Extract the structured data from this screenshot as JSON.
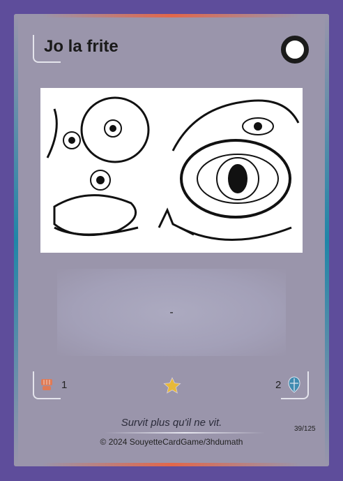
{
  "card": {
    "title": "Jo la frite",
    "effect_text": "-",
    "attack": "1",
    "defense": "2",
    "flavor_text": "Survit plus qu'il ne vit.",
    "copyright": "© 2024 SouyetteCardGame/3hdumath",
    "card_number": "39/125"
  },
  "colors": {
    "background": "#5e4d9b",
    "card": "#9a95ab",
    "accent": "#e2674a",
    "edge": "#1f86a8",
    "attack": "#e07a55",
    "defense": "#3f8bb0",
    "star": "#e8b93a"
  }
}
